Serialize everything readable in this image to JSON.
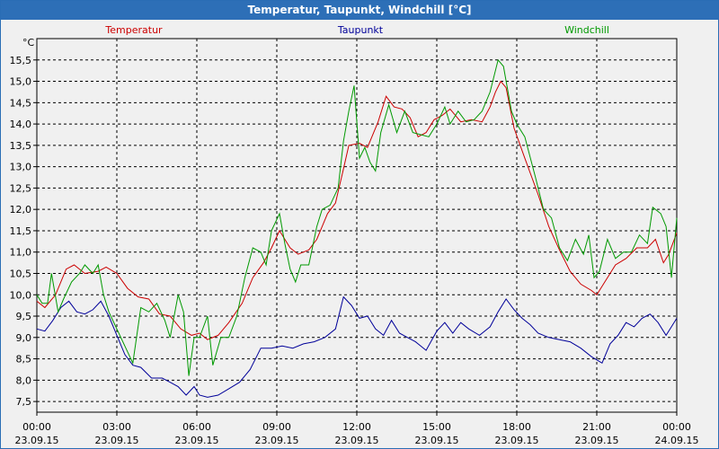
{
  "window": {
    "title": "Temperatur, Taupunkt, Windchill [°C]"
  },
  "chart_data": {
    "type": "line",
    "title": "Temperatur, Taupunkt, Windchill [°C]",
    "ylabel": "°C",
    "ylim": [
      7.25,
      16.0
    ],
    "xlim": [
      0,
      24
    ],
    "grid": true,
    "legend_placement": "top",
    "yticks": [
      "7,5",
      "8,0",
      "8,5",
      "9,0",
      "9,5",
      "10,0",
      "10,5",
      "11,0",
      "11,5",
      "12,0",
      "12,5",
      "13,0",
      "13,5",
      "14,0",
      "14,5",
      "15,0",
      "15,5"
    ],
    "xticks": [
      {
        "time": "00:00",
        "date": "23.09.15"
      },
      {
        "time": "03:00",
        "date": "23.09.15"
      },
      {
        "time": "06:00",
        "date": "23.09.15"
      },
      {
        "time": "09:00",
        "date": "23.09.15"
      },
      {
        "time": "12:00",
        "date": "23.09.15"
      },
      {
        "time": "15:00",
        "date": "23.09.15"
      },
      {
        "time": "18:00",
        "date": "23.09.15"
      },
      {
        "time": "21:00",
        "date": "23.09.15"
      },
      {
        "time": "00:00",
        "date": "24.09.15"
      }
    ],
    "series": [
      {
        "name": "Temperatur",
        "color": "#cc0000",
        "points": [
          [
            0,
            9.85
          ],
          [
            0.3,
            9.7
          ],
          [
            0.7,
            10.0
          ],
          [
            1.1,
            10.6
          ],
          [
            1.4,
            10.7
          ],
          [
            1.8,
            10.5
          ],
          [
            2.3,
            10.55
          ],
          [
            2.6,
            10.65
          ],
          [
            3.0,
            10.5
          ],
          [
            3.4,
            10.15
          ],
          [
            3.8,
            9.95
          ],
          [
            4.2,
            9.9
          ],
          [
            4.6,
            9.55
          ],
          [
            5.0,
            9.5
          ],
          [
            5.4,
            9.2
          ],
          [
            5.8,
            9.05
          ],
          [
            6.1,
            9.1
          ],
          [
            6.4,
            8.95
          ],
          [
            6.8,
            9.05
          ],
          [
            7.2,
            9.35
          ],
          [
            7.7,
            9.8
          ],
          [
            8.1,
            10.4
          ],
          [
            8.5,
            10.75
          ],
          [
            8.8,
            11.1
          ],
          [
            9.1,
            11.5
          ],
          [
            9.5,
            11.1
          ],
          [
            9.8,
            10.95
          ],
          [
            10.2,
            11.05
          ],
          [
            10.5,
            11.3
          ],
          [
            10.9,
            11.9
          ],
          [
            11.2,
            12.15
          ],
          [
            11.5,
            12.95
          ],
          [
            11.7,
            13.5
          ],
          [
            12.1,
            13.55
          ],
          [
            12.4,
            13.45
          ],
          [
            12.8,
            14.05
          ],
          [
            13.1,
            14.65
          ],
          [
            13.4,
            14.4
          ],
          [
            13.7,
            14.35
          ],
          [
            14.0,
            14.15
          ],
          [
            14.3,
            13.7
          ],
          [
            14.6,
            13.8
          ],
          [
            14.9,
            14.1
          ],
          [
            15.2,
            14.2
          ],
          [
            15.5,
            14.35
          ],
          [
            15.9,
            14.05
          ],
          [
            16.3,
            14.1
          ],
          [
            16.7,
            14.05
          ],
          [
            17.0,
            14.4
          ],
          [
            17.2,
            14.75
          ],
          [
            17.4,
            15.0
          ],
          [
            17.6,
            14.85
          ],
          [
            17.9,
            13.9
          ],
          [
            18.3,
            13.2
          ],
          [
            18.8,
            12.35
          ],
          [
            19.2,
            11.6
          ],
          [
            19.6,
            11.05
          ],
          [
            20.0,
            10.55
          ],
          [
            20.4,
            10.25
          ],
          [
            20.8,
            10.1
          ],
          [
            21.0,
            10.0
          ],
          [
            21.3,
            10.3
          ],
          [
            21.7,
            10.7
          ],
          [
            22.1,
            10.85
          ],
          [
            22.5,
            11.1
          ],
          [
            22.9,
            11.1
          ],
          [
            23.2,
            11.3
          ],
          [
            23.5,
            10.75
          ],
          [
            23.7,
            10.95
          ],
          [
            24.0,
            11.45
          ]
        ]
      },
      {
        "name": "Taupunkt",
        "color": "#000099",
        "points": [
          [
            0,
            9.2
          ],
          [
            0.3,
            9.15
          ],
          [
            0.6,
            9.4
          ],
          [
            0.9,
            9.7
          ],
          [
            1.2,
            9.85
          ],
          [
            1.5,
            9.6
          ],
          [
            1.8,
            9.55
          ],
          [
            2.1,
            9.65
          ],
          [
            2.4,
            9.85
          ],
          [
            2.7,
            9.5
          ],
          [
            3.0,
            9.05
          ],
          [
            3.3,
            8.6
          ],
          [
            3.6,
            8.35
          ],
          [
            3.9,
            8.3
          ],
          [
            4.3,
            8.05
          ],
          [
            4.7,
            8.05
          ],
          [
            5.0,
            7.95
          ],
          [
            5.3,
            7.85
          ],
          [
            5.6,
            7.65
          ],
          [
            5.9,
            7.85
          ],
          [
            6.1,
            7.65
          ],
          [
            6.4,
            7.6
          ],
          [
            6.8,
            7.65
          ],
          [
            7.2,
            7.8
          ],
          [
            7.6,
            7.95
          ],
          [
            8.0,
            8.25
          ],
          [
            8.4,
            8.75
          ],
          [
            8.8,
            8.75
          ],
          [
            9.2,
            8.8
          ],
          [
            9.6,
            8.75
          ],
          [
            10.0,
            8.85
          ],
          [
            10.4,
            8.9
          ],
          [
            10.8,
            9.0
          ],
          [
            11.2,
            9.2
          ],
          [
            11.5,
            9.95
          ],
          [
            11.8,
            9.75
          ],
          [
            12.1,
            9.45
          ],
          [
            12.4,
            9.5
          ],
          [
            12.7,
            9.2
          ],
          [
            13.0,
            9.05
          ],
          [
            13.3,
            9.4
          ],
          [
            13.6,
            9.1
          ],
          [
            13.9,
            9.0
          ],
          [
            14.2,
            8.9
          ],
          [
            14.6,
            8.7
          ],
          [
            15.0,
            9.15
          ],
          [
            15.3,
            9.35
          ],
          [
            15.6,
            9.1
          ],
          [
            15.9,
            9.35
          ],
          [
            16.2,
            9.2
          ],
          [
            16.6,
            9.05
          ],
          [
            17.0,
            9.25
          ],
          [
            17.3,
            9.6
          ],
          [
            17.6,
            9.9
          ],
          [
            17.9,
            9.65
          ],
          [
            18.2,
            9.45
          ],
          [
            18.5,
            9.3
          ],
          [
            18.8,
            9.1
          ],
          [
            19.2,
            9.0
          ],
          [
            19.6,
            8.95
          ],
          [
            20.0,
            8.9
          ],
          [
            20.4,
            8.75
          ],
          [
            20.8,
            8.55
          ],
          [
            21.2,
            8.4
          ],
          [
            21.5,
            8.85
          ],
          [
            21.8,
            9.05
          ],
          [
            22.1,
            9.35
          ],
          [
            22.4,
            9.25
          ],
          [
            22.7,
            9.45
          ],
          [
            23.0,
            9.55
          ],
          [
            23.3,
            9.35
          ],
          [
            23.6,
            9.05
          ],
          [
            23.8,
            9.25
          ],
          [
            24.0,
            9.45
          ]
        ]
      },
      {
        "name": "Windchill",
        "color": "#009900",
        "points": [
          [
            0,
            10.0
          ],
          [
            0.2,
            9.8
          ],
          [
            0.4,
            9.8
          ],
          [
            0.55,
            10.5
          ],
          [
            0.8,
            9.6
          ],
          [
            1.0,
            9.9
          ],
          [
            1.3,
            10.3
          ],
          [
            1.6,
            10.5
          ],
          [
            1.8,
            10.7
          ],
          [
            2.1,
            10.5
          ],
          [
            2.3,
            10.7
          ],
          [
            2.5,
            10.0
          ],
          [
            2.7,
            9.6
          ],
          [
            3.0,
            9.2
          ],
          [
            3.3,
            8.8
          ],
          [
            3.6,
            8.4
          ],
          [
            3.9,
            9.7
          ],
          [
            4.2,
            9.6
          ],
          [
            4.5,
            9.8
          ],
          [
            4.8,
            9.4
          ],
          [
            5.0,
            9.0
          ],
          [
            5.3,
            10.0
          ],
          [
            5.5,
            9.6
          ],
          [
            5.7,
            8.1
          ],
          [
            5.9,
            9.0
          ],
          [
            6.1,
            9.0
          ],
          [
            6.4,
            9.5
          ],
          [
            6.6,
            8.35
          ],
          [
            6.9,
            9.0
          ],
          [
            7.2,
            9.0
          ],
          [
            7.5,
            9.5
          ],
          [
            7.8,
            10.4
          ],
          [
            8.1,
            11.1
          ],
          [
            8.4,
            11.0
          ],
          [
            8.6,
            10.7
          ],
          [
            8.8,
            11.5
          ],
          [
            9.1,
            11.9
          ],
          [
            9.3,
            11.2
          ],
          [
            9.5,
            10.6
          ],
          [
            9.7,
            10.3
          ],
          [
            9.9,
            10.7
          ],
          [
            10.2,
            10.7
          ],
          [
            10.5,
            11.6
          ],
          [
            10.7,
            12.0
          ],
          [
            11.0,
            12.1
          ],
          [
            11.3,
            12.5
          ],
          [
            11.5,
            13.6
          ],
          [
            11.7,
            14.3
          ],
          [
            11.9,
            14.9
          ],
          [
            12.1,
            13.2
          ],
          [
            12.3,
            13.45
          ],
          [
            12.5,
            13.1
          ],
          [
            12.7,
            12.9
          ],
          [
            12.9,
            13.8
          ],
          [
            13.2,
            14.45
          ],
          [
            13.5,
            13.8
          ],
          [
            13.8,
            14.3
          ],
          [
            14.1,
            13.8
          ],
          [
            14.4,
            13.75
          ],
          [
            14.7,
            13.7
          ],
          [
            15.0,
            14.0
          ],
          [
            15.3,
            14.4
          ],
          [
            15.5,
            14.0
          ],
          [
            15.8,
            14.3
          ],
          [
            16.1,
            14.05
          ],
          [
            16.4,
            14.1
          ],
          [
            16.7,
            14.3
          ],
          [
            17.0,
            14.75
          ],
          [
            17.3,
            15.5
          ],
          [
            17.5,
            15.35
          ],
          [
            17.8,
            14.3
          ],
          [
            18.0,
            14.0
          ],
          [
            18.3,
            13.7
          ],
          [
            18.7,
            12.75
          ],
          [
            19.0,
            12.0
          ],
          [
            19.3,
            11.8
          ],
          [
            19.6,
            11.1
          ],
          [
            19.9,
            10.8
          ],
          [
            20.2,
            11.3
          ],
          [
            20.5,
            10.95
          ],
          [
            20.7,
            11.4
          ],
          [
            20.9,
            10.4
          ],
          [
            21.1,
            10.55
          ],
          [
            21.4,
            11.3
          ],
          [
            21.7,
            10.85
          ],
          [
            22.0,
            11.0
          ],
          [
            22.3,
            11.0
          ],
          [
            22.6,
            11.4
          ],
          [
            22.9,
            11.2
          ],
          [
            23.1,
            12.05
          ],
          [
            23.4,
            11.9
          ],
          [
            23.6,
            11.6
          ],
          [
            23.8,
            10.4
          ],
          [
            24.0,
            11.8
          ]
        ]
      }
    ]
  }
}
